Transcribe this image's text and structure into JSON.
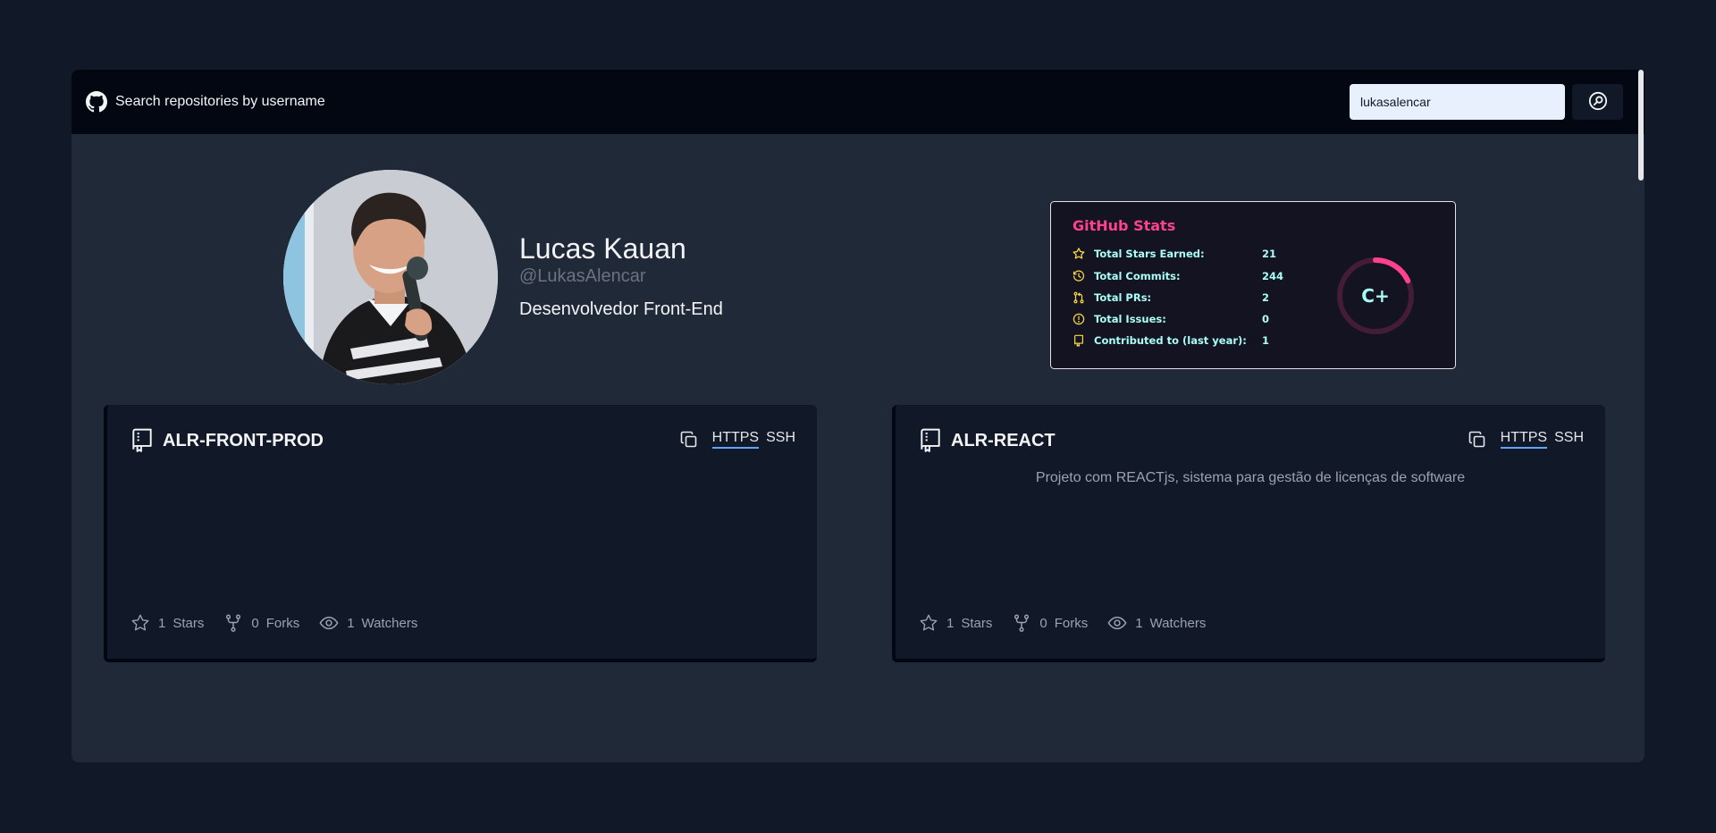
{
  "header": {
    "title": "Search repositories by username",
    "search_value": "lukasalencar",
    "brand_icon": "github-icon",
    "search_icon": "search-icon"
  },
  "profile": {
    "name": "Lucas Kauan",
    "handle": "@LukasAlencar",
    "bio": "Desenvolvedor Front-End"
  },
  "stats": {
    "title": "GitHub Stats",
    "rank": "C+",
    "rank_progress": 0.18,
    "colors": {
      "title": "#fe428e",
      "text": "#a9fef7",
      "icon": "#f8d847",
      "background": "#141321"
    },
    "items": [
      {
        "label": "Total Stars Earned:",
        "value": "21",
        "icon": "star-icon"
      },
      {
        "label": "Total Commits:",
        "value": "244",
        "icon": "history-icon"
      },
      {
        "label": "Total PRs:",
        "value": "2",
        "icon": "pull-request-icon"
      },
      {
        "label": "Total Issues:",
        "value": "0",
        "icon": "issue-icon"
      },
      {
        "label": "Contributed to (last year):",
        "value": "1",
        "icon": "repo-icon"
      }
    ]
  },
  "repos": [
    {
      "name": "ALR-FRONT-PROD",
      "description": "",
      "stars": "1",
      "stars_label": "Stars",
      "forks": "0",
      "forks_label": "Forks",
      "watchers": "1",
      "watchers_label": "Watchers",
      "tab_https": "HTTPS",
      "tab_ssh": "SSH"
    },
    {
      "name": "ALR-REACT",
      "description": "Projeto com REACTjs, sistema para gestão de licenças de software",
      "stars": "1",
      "stars_label": "Stars",
      "forks": "0",
      "forks_label": "Forks",
      "watchers": "1",
      "watchers_label": "Watchers",
      "tab_https": "HTTPS",
      "tab_ssh": "SSH"
    }
  ],
  "theme": {
    "accent": "#60a5fa",
    "page_background": "#111827",
    "panel_background": "#1f2937",
    "topbar_background": "#030712"
  }
}
